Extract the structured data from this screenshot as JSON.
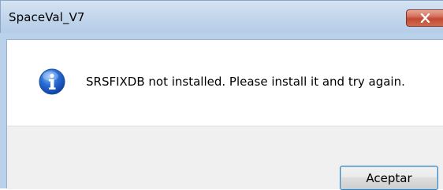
{
  "window": {
    "title": "SpaceVal_V7"
  },
  "dialog": {
    "icon": "info-icon",
    "message": "SRSFIXDB not installed.  Please install it and try again.",
    "accept_label": "Aceptar"
  },
  "colors": {
    "titlebar": "#c4d7ec",
    "close_button": "#c24a33",
    "footer": "#f0f0f0",
    "button_border": "#3c7fb1"
  }
}
